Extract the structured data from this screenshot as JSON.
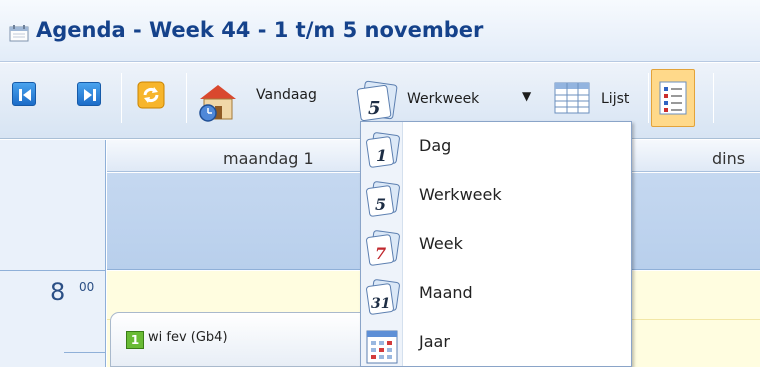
{
  "window": {
    "title": "Agenda - Week 44 - 1 t/m 5 november",
    "title_icon": "calendar-icon"
  },
  "toolbar": {
    "prev_icon": "previous-icon",
    "next_icon": "next-icon",
    "refresh_icon": "refresh-icon",
    "today_label": "Vandaag",
    "today_icon": "home-clock-icon",
    "view_label": "Werkweek",
    "view_icon": "calendar-5-icon",
    "view_arrow": "▼",
    "list_label": "Lijst",
    "list_icon": "table-icon",
    "details_icon": "list-details-icon"
  },
  "calendar": {
    "days": [
      "maandag 1",
      "dins"
    ],
    "hour": "8",
    "hour_suffix": "00",
    "appointment": {
      "badge": "1",
      "text": "wi fev (Gb4)"
    }
  },
  "dropdown": {
    "items": [
      {
        "label": "Dag",
        "icon": "calendar-1-icon",
        "icon_text": "1"
      },
      {
        "label": "Werkweek",
        "icon": "calendar-5-icon",
        "icon_text": "5"
      },
      {
        "label": "Week",
        "icon": "calendar-7-icon",
        "icon_text": "7"
      },
      {
        "label": "Maand",
        "icon": "calendar-31-icon",
        "icon_text": "31"
      },
      {
        "label": "Jaar",
        "icon": "calendar-grid-icon",
        "icon_text": ""
      }
    ]
  },
  "colors": {
    "title_text": "#15428b",
    "accent_blue": "#1c6cc8",
    "hour_area": "#fffde0",
    "allday_row": "#c5d8f0"
  }
}
